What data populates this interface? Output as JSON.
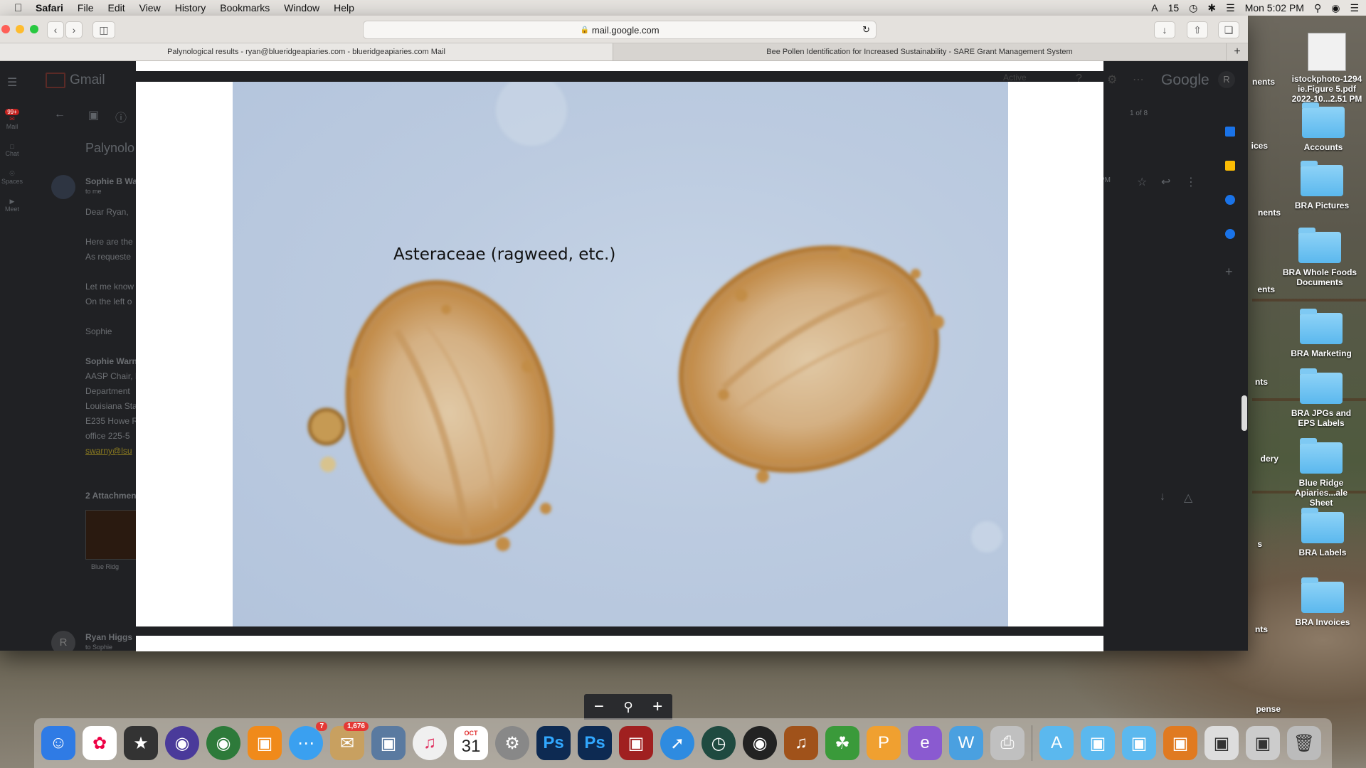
{
  "menubar": {
    "app": "Safari",
    "items": [
      "File",
      "Edit",
      "View",
      "History",
      "Bookmarks",
      "Window",
      "Help"
    ],
    "status_a": "15",
    "clock": "Mon 5:02 PM"
  },
  "browser": {
    "url": "mail.google.com",
    "tabs": [
      "Palynological results - ryan@blueridgeapiaries.com - blueridgeapiaries.com Mail",
      "Bee Pollen Identification for Increased Sustainability - SARE Grant Management System"
    ]
  },
  "gmail": {
    "logo": "Gmail",
    "google": "Google",
    "avatar": "R",
    "nav": [
      "Mail",
      "Chat",
      "Spaces",
      "Meet"
    ],
    "mail_badge": "99+",
    "subject": "Palynolo",
    "sender": "Sophie B Wa",
    "to_me": "to me",
    "body_lines": [
      "Dear Ryan,",
      "Here are the",
      "As requeste",
      "Let me know",
      "On the left o",
      "Sophie",
      "Sophie Warn",
      "AASP Chair, P",
      "Department",
      "Louisiana Sta",
      "E235 Howe R",
      "office 225-5",
      "swarny@lsu"
    ],
    "attachments": "2 Attachmen",
    "attachment_name": "Blue Ridg",
    "reply_sender": "Ryan Higgs",
    "reply_to": "to Sophie",
    "page_count": "1 of 8",
    "time_label": "PM",
    "status": "Active"
  },
  "viewer": {
    "caption": "Asteraceae (ragweed, etc.)",
    "zoom_out": "−",
    "zoom_icon": "magnifier-icon",
    "zoom_in": "+"
  },
  "desktop": {
    "top_file": "istockphoto-1294",
    "top_file2": "ie.Figure 5.pdf",
    "top_file3": "2022-10...2.51 PM",
    "folders": [
      "Accounts",
      "BRA Pictures",
      "BRA Whole Foods Documents",
      "BRA Marketing",
      "BRA JPGs and EPS Labels",
      "Blue Ridge Apiaries...ale Sheet",
      "BRA Labels",
      "BRA Invoices"
    ],
    "partial_labels": [
      "nents",
      "ices",
      "nents",
      "ents",
      "nts",
      "dery",
      "s",
      "nts",
      "pense"
    ]
  },
  "dock": {
    "mail_badge": "7",
    "photos_badge": "1,676",
    "calendar_month": "OCT",
    "calendar_day": "31"
  },
  "colors": {
    "accent": "#1a73e8",
    "gmail_bg": "#202124",
    "folder": "#5bb8ee"
  }
}
